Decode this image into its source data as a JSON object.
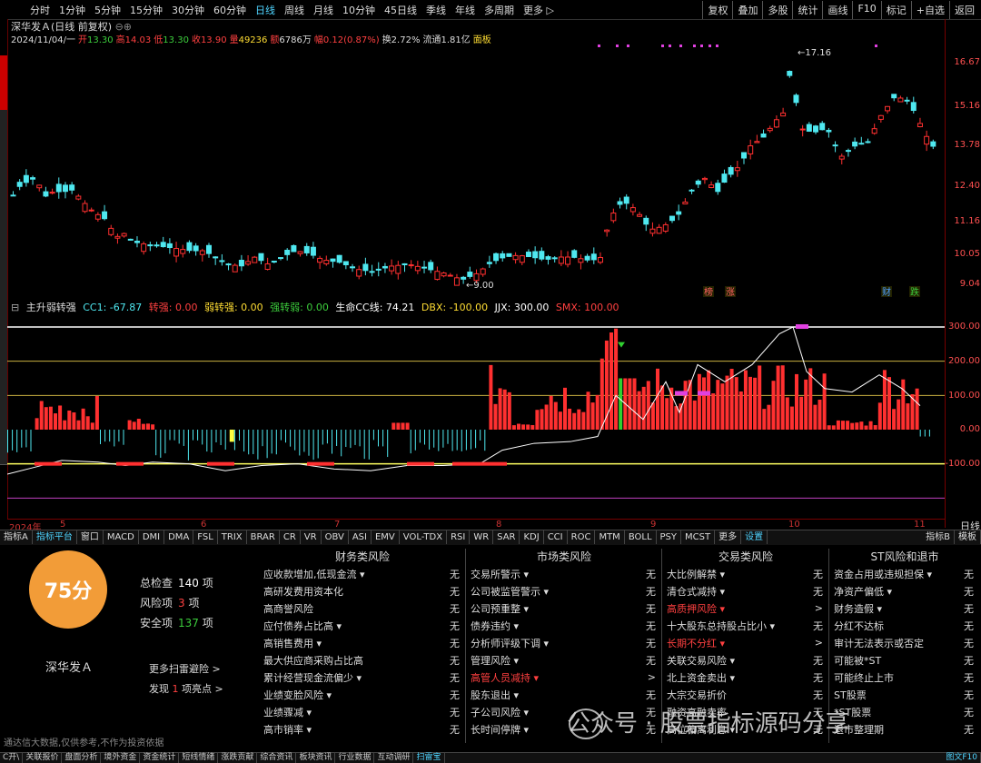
{
  "top_tabs": [
    "分时",
    "1分钟",
    "5分钟",
    "15分钟",
    "30分钟",
    "60分钟",
    "日线",
    "周线",
    "月线",
    "10分钟",
    "45日线",
    "季线",
    "年线",
    "多周期",
    "更多 ▷"
  ],
  "active_tab": "日线",
  "right_tools": [
    "复权",
    "叠加",
    "多股",
    "统计",
    "画线",
    "F10",
    "标记",
    "+自选",
    "返回"
  ],
  "stock_title": "深华发Ａ(日线 前复权)",
  "quote": {
    "date": "2024/11/04/一",
    "open_label": "开",
    "open": "13.30",
    "high_label": "高",
    "high": "14.03",
    "low_label": "低",
    "low": "13.30",
    "close_label": "收",
    "close": "13.90",
    "vol_label": "量",
    "vol": "49236",
    "amt_label": "额",
    "amt": "6786万",
    "chg_label": "幅",
    "chg": "0.12(0.87%)",
    "turn": "换2.72%",
    "float": "流通1.81亿",
    "face": "面板"
  },
  "price_axis": [
    "16.67",
    "15.16",
    "13.78",
    "12.40",
    "11.16",
    "10.05",
    "9.04"
  ],
  "price_marks": {
    "high": "17.16",
    "low": "9.00"
  },
  "main_tags": [
    "榜",
    "涨",
    "财",
    "跌"
  ],
  "indicator": {
    "name": "主升弱转强",
    "cc1": "CC1: -67.87",
    "zq": "转强: 0.00",
    "rzq": "弱转强: 0.00",
    "qzr": "强转弱: 0.00",
    "smx": "生命CC线: 74.21",
    "dbx": "DBX: -100.00",
    "jjx": "JJX: 300.00",
    "smx2": "SMX: 100.00"
  },
  "ind_axis": [
    "300.00",
    "200.00",
    "100.00",
    "0.00",
    "-100.00"
  ],
  "date_axis": [
    "2024年",
    "5",
    "6",
    "7",
    "8",
    "9",
    "10",
    "11"
  ],
  "right_date_label": "日线",
  "bottom_tabs": [
    "指标A",
    "指标平台",
    "窗口",
    "MACD",
    "DMI",
    "DMA",
    "FSL",
    "TRIX",
    "BRAR",
    "CR",
    "VR",
    "OBV",
    "ASI",
    "EMV",
    "VOL-TDX",
    "RSI",
    "WR",
    "SAR",
    "KDJ",
    "CCI",
    "ROC",
    "MTM",
    "BOLL",
    "PSY",
    "MCST",
    "更多",
    "设置"
  ],
  "bottom_tabs_right": [
    "模板",
    "指标B"
  ],
  "risk": {
    "score": "75分",
    "stock_name": "深华发Ａ",
    "total_label": "总检查",
    "total": "140",
    "total_unit": "项",
    "risk_label": "风险项",
    "risk_count": "3",
    "risk_unit": "项",
    "safe_label": "安全项",
    "safe_count": "137",
    "safe_unit": "项",
    "more_link": "更多扫雷避险 >",
    "found_pre": "发现",
    "found_count": "1",
    "found_post": "项亮点 >",
    "disclaimer": "通达信大数据,仅供参考,不作为投资依据",
    "columns": [
      {
        "title": "财务类风险",
        "rows": [
          [
            "应收款增加,低现金流 ▾",
            "无"
          ],
          [
            "高研发费用资本化",
            "无"
          ],
          [
            "高商誉风险",
            "无"
          ],
          [
            "应付债券占比高 ▾",
            "无"
          ],
          [
            "高销售费用 ▾",
            "无"
          ],
          [
            "最大供应商采购占比高",
            "无"
          ],
          [
            "累计经营现金流偏少 ▾",
            "无"
          ],
          [
            "业绩变脸风险 ▾",
            "无"
          ],
          [
            "业绩骤减 ▾",
            "无"
          ],
          [
            "高市销率 ▾",
            "无"
          ]
        ]
      },
      {
        "title": "市场类风险",
        "rows": [
          [
            "交易所警示 ▾",
            "无"
          ],
          [
            "公司被监管警示 ▾",
            "无"
          ],
          [
            "公司预重整 ▾",
            "无"
          ],
          [
            "债券违约 ▾",
            "无"
          ],
          [
            "分析师评级下调 ▾",
            "无"
          ],
          [
            "管理风险 ▾",
            "无"
          ],
          [
            "高管人员减持 ▾",
            ">"
          ],
          [
            "股东退出 ▾",
            "无"
          ],
          [
            "子公司风险 ▾",
            "无"
          ],
          [
            "长时间停牌 ▾",
            "无"
          ]
        ]
      },
      {
        "title": "交易类风险",
        "rows": [
          [
            "大比例解禁 ▾",
            "无"
          ],
          [
            "清仓式减持 ▾",
            "无"
          ],
          [
            "高质押风险 ▾",
            ">"
          ],
          [
            "十大股东总持股占比小 ▾",
            "无"
          ],
          [
            "长期不分红 ▾",
            ">"
          ],
          [
            "关联交易风险 ▾",
            "无"
          ],
          [
            "北上资金卖出 ▾",
            "无"
          ],
          [
            "大宗交易折价",
            "无"
          ],
          [
            "融资高融卖率",
            "无"
          ],
          [
            "高位偏离利息 ▾",
            "无"
          ]
        ]
      },
      {
        "title": "ST风险和退市",
        "rows": [
          [
            "资金占用或违规担保 ▾",
            "无"
          ],
          [
            "净资产偏低 ▾",
            "无"
          ],
          [
            "财务造假 ▾",
            "无"
          ],
          [
            "分红不达标",
            "无"
          ],
          [
            "审计无法表示或否定",
            "无"
          ],
          [
            "可能被*ST",
            "无"
          ],
          [
            "可能终止上市",
            "无"
          ],
          [
            "ST股票",
            "无"
          ],
          [
            "*ST股票",
            "无"
          ],
          [
            "退市整理期",
            "无"
          ]
        ]
      }
    ],
    "highlight_rows": [
      [
        1,
        6
      ],
      [
        2,
        2
      ],
      [
        2,
        4
      ]
    ]
  },
  "bottom_bar": [
    "C开\\",
    "关联报价",
    "盘面分析",
    "境外资金",
    "资金统计",
    "短线情绪",
    "涨跌贡献",
    "综合资讯",
    "板块资讯",
    "行业数据",
    "互动调研",
    "扫雷宝"
  ],
  "bottom_bar_right": "图文F10",
  "watermark": "公众号 · 股票指标源码分享",
  "colors": {
    "up": "#ff3030",
    "down": "#4fe8f0",
    "accent": "#4fd4ff",
    "score": "#f29c38"
  }
}
